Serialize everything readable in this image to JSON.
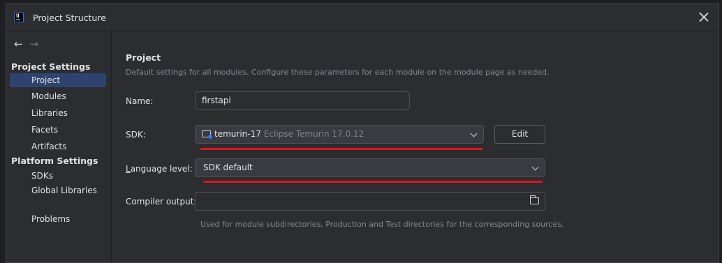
{
  "window": {
    "title": "Project Structure",
    "logo_text": "IJ"
  },
  "navigation": {
    "back": "←",
    "forward": "→"
  },
  "sidebar": {
    "project_settings_header": "Project Settings",
    "project_settings_items": [
      {
        "label": "Project",
        "selected": true
      },
      {
        "label": "Modules"
      },
      {
        "label": "Libraries"
      },
      {
        "label": "Facets"
      },
      {
        "label": "Artifacts"
      }
    ],
    "platform_settings_header": "Platform Settings",
    "platform_settings_items": [
      {
        "label": "SDKs"
      },
      {
        "label": "Global Libraries"
      }
    ],
    "problems": "Problems"
  },
  "main": {
    "heading": "Project",
    "description": "Default settings for all modules. Configure these parameters for each module on the module page as needed.",
    "name_label": "Name:",
    "name_value": "firstapi",
    "sdk_label": "SDK:",
    "sdk_name": "temurin-17",
    "sdk_detail": "Eclipse Temurin 17.0.12",
    "edit_button": "Edit",
    "language_level_label_prefix": "L",
    "language_level_label_rest": "anguage level:",
    "language_level_value": "SDK default",
    "compiler_output_label": "Compiler output:",
    "compiler_output_value": "",
    "compiler_output_hint": "Used for module subdirectories, Production and Test directories for the corresponding sources."
  },
  "colors": {
    "accent": "#2e436e",
    "annotation": "#e0141f",
    "sdk_icon": "#3574f0"
  }
}
